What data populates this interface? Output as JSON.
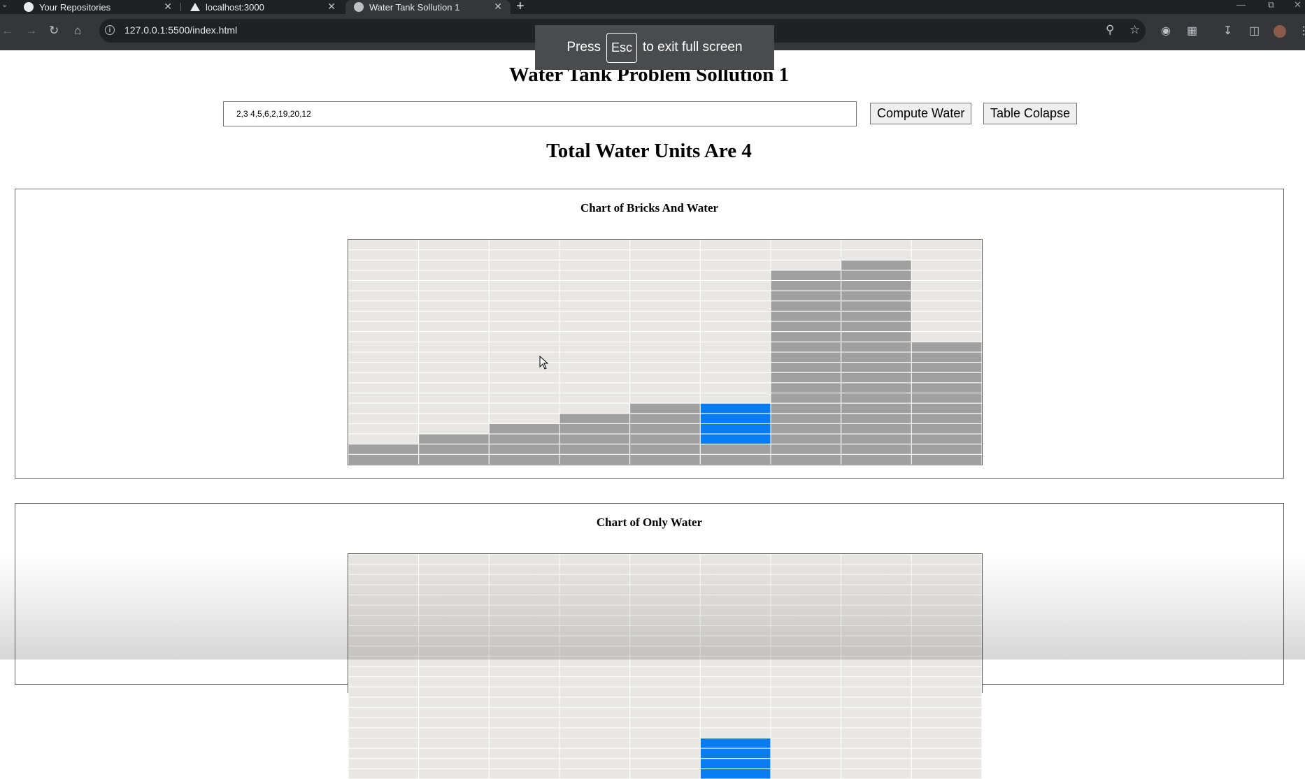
{
  "browser": {
    "tabs": [
      {
        "label": "Your Repositories",
        "icon": "github-icon",
        "active": false
      },
      {
        "label": "localhost:3000",
        "icon": "triangle-icon",
        "active": false
      },
      {
        "label": "Water Tank Sollution 1",
        "icon": "globe-icon",
        "active": true
      }
    ],
    "url": "127.0.0.1:5500/index.html",
    "fullscreen_toast": {
      "before": "Press",
      "key": "Esc",
      "after": "to exit full screen"
    }
  },
  "page": {
    "title": "Water Tank Problem Sollution 1",
    "input_value": "2,3 4,5,6,2,19,20,12",
    "compute_button": "Compute Water",
    "collapse_button": "Table Colapse",
    "total": "Total Water Units Are 4"
  },
  "chart_data": [
    {
      "type": "table",
      "title": "Chart of Bricks And Water",
      "columns": 9,
      "rows": 22,
      "bricks": [
        2,
        3,
        4,
        5,
        6,
        2,
        19,
        20,
        12
      ],
      "water": [
        0,
        0,
        0,
        0,
        0,
        4,
        0,
        0,
        0
      ],
      "colors": {
        "empty": "#e9e7e3",
        "brick": "#a0a0a0",
        "water": "#0a7cf2"
      }
    },
    {
      "type": "table",
      "title": "Chart of Only Water",
      "columns": 9,
      "rows": 22,
      "bricks": [
        0,
        0,
        0,
        0,
        0,
        0,
        0,
        0,
        0
      ],
      "water": [
        0,
        0,
        0,
        0,
        0,
        4,
        0,
        0,
        0
      ],
      "colors": {
        "empty": "#e9e7e3",
        "brick": "#a0a0a0",
        "water": "#0a7cf2"
      }
    }
  ]
}
